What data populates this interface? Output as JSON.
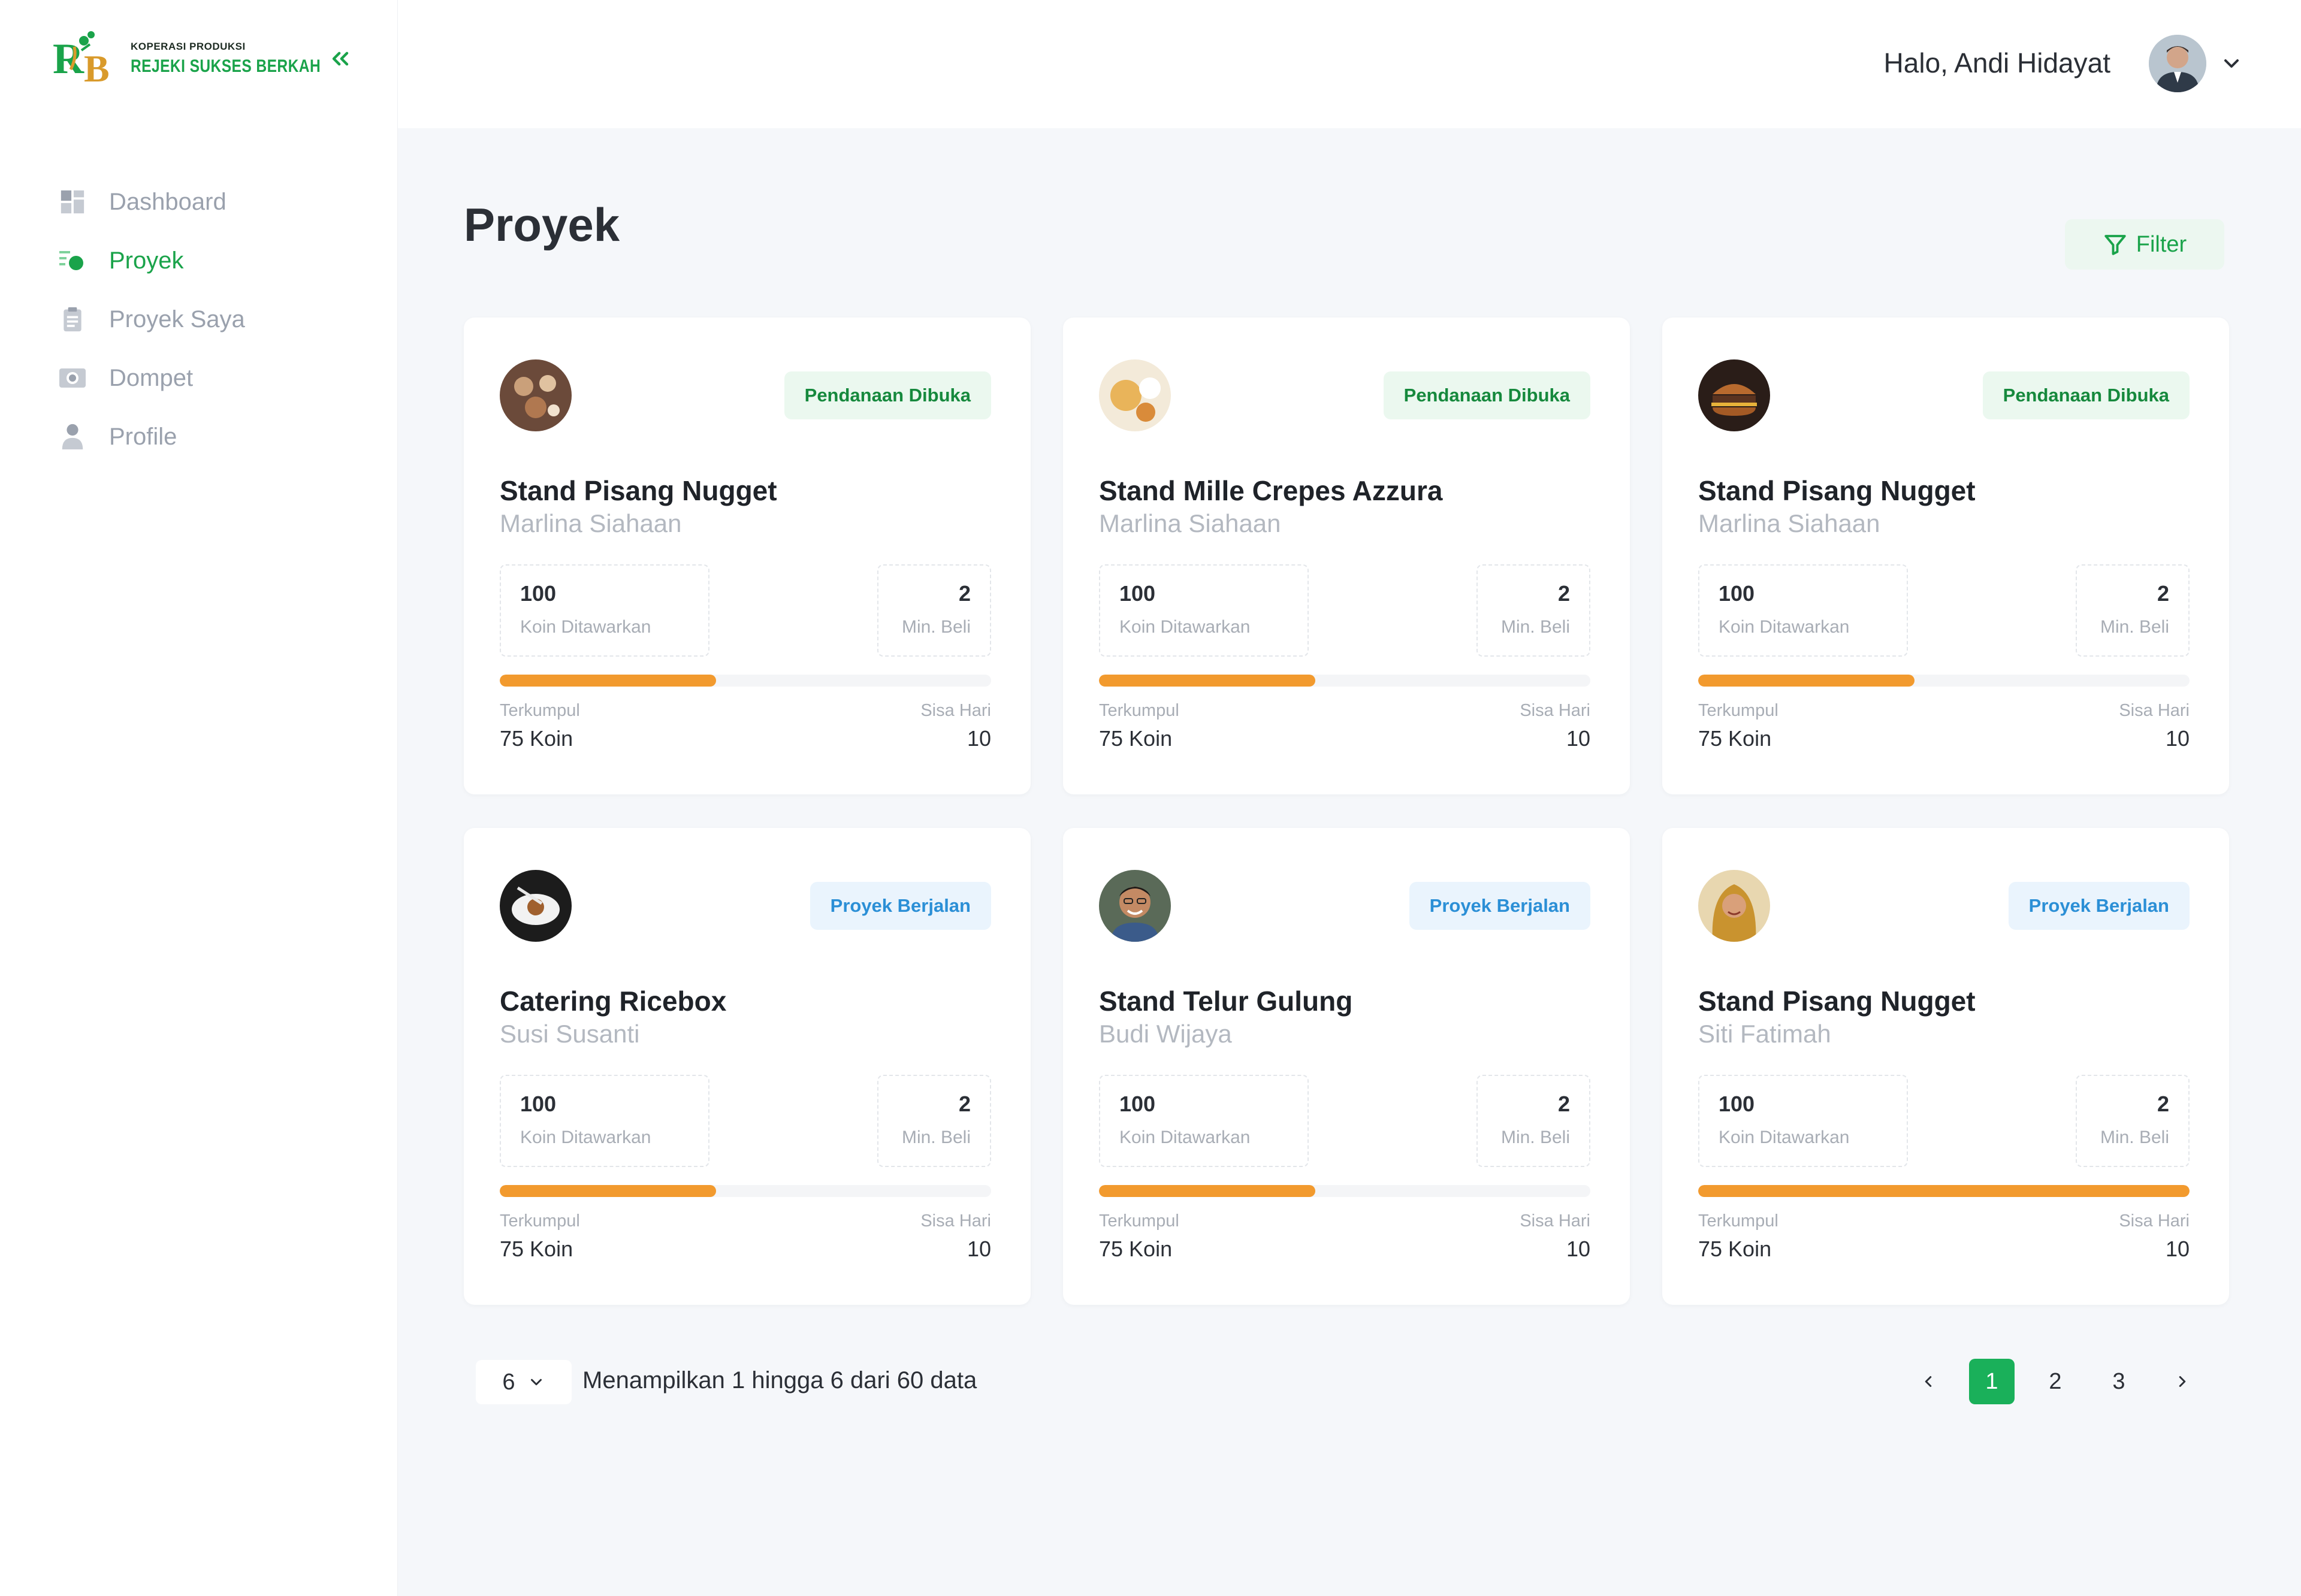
{
  "brand": {
    "small": "KOPERASI PRODUKSI",
    "name": "REJEKI SUKSES BERKAH",
    "accent": "#1aa34a",
    "gold": "#d99a2b"
  },
  "sidebar": {
    "items": [
      {
        "label": "Dashboard",
        "icon": "dashboard-icon",
        "active": false
      },
      {
        "label": "Proyek",
        "icon": "proyek-icon",
        "active": true
      },
      {
        "label": "Proyek Saya",
        "icon": "clipboard-icon",
        "active": false
      },
      {
        "label": "Dompet",
        "icon": "wallet-icon",
        "active": false
      },
      {
        "label": "Profile",
        "icon": "user-icon",
        "active": false
      }
    ]
  },
  "header": {
    "greeting": "Halo, Andi Hidayat"
  },
  "main": {
    "title": "Proyek",
    "filter_label": "Filter",
    "cards": [
      {
        "title": "Stand Pisang Nugget",
        "owner": "Marlina Siahaan",
        "status": "Pendanaan Dibuka",
        "status_type": "open",
        "koin": "100",
        "koin_label": "Koin Ditawarkan",
        "min": "2",
        "min_label": "Min. Beli",
        "progress": 0.44,
        "collected_label": "Terkumpul",
        "collected": "75 Koin",
        "days_label": "Sisa Hari",
        "days": "10",
        "avatar": "food-avatar"
      },
      {
        "title": "Stand Mille Crepes Azzura",
        "owner": "Marlina Siahaan",
        "status": "Pendanaan Dibuka",
        "status_type": "open",
        "koin": "100",
        "koin_label": "Koin Ditawarkan",
        "min": "2",
        "min_label": "Min. Beli",
        "progress": 0.44,
        "collected_label": "Terkumpul",
        "collected": "75 Koin",
        "days_label": "Sisa Hari",
        "days": "10",
        "avatar": "crepes-avatar"
      },
      {
        "title": "Stand Pisang Nugget",
        "owner": "Marlina Siahaan",
        "status": "Pendanaan Dibuka",
        "status_type": "open",
        "koin": "100",
        "koin_label": "Koin Ditawarkan",
        "min": "2",
        "min_label": "Min. Beli",
        "progress": 0.44,
        "collected_label": "Terkumpul",
        "collected": "75 Koin",
        "days_label": "Sisa Hari",
        "days": "10",
        "avatar": "burger-avatar"
      },
      {
        "title": "Catering Ricebox",
        "owner": "Susi Susanti",
        "status": "Proyek Berjalan",
        "status_type": "running",
        "koin": "100",
        "koin_label": "Koin Ditawarkan",
        "min": "2",
        "min_label": "Min. Beli",
        "progress": 0.44,
        "collected_label": "Terkumpul",
        "collected": "75 Koin",
        "days_label": "Sisa Hari",
        "days": "10",
        "avatar": "plate-avatar"
      },
      {
        "title": "Stand Telur Gulung",
        "owner": "Budi Wijaya",
        "status": "Proyek Berjalan",
        "status_type": "running",
        "koin": "100",
        "koin_label": "Koin Ditawarkan",
        "min": "2",
        "min_label": "Min. Beli",
        "progress": 0.44,
        "collected_label": "Terkumpul",
        "collected": "75 Koin",
        "days_label": "Sisa Hari",
        "days": "10",
        "avatar": "man-avatar"
      },
      {
        "title": "Stand Pisang Nugget",
        "owner": "Siti Fatimah",
        "status": "Proyek Berjalan",
        "status_type": "running",
        "koin": "100",
        "koin_label": "Koin Ditawarkan",
        "min": "2",
        "min_label": "Min. Beli",
        "progress": 1.0,
        "collected_label": "Terkumpul",
        "collected": "75 Koin",
        "days_label": "Sisa Hari",
        "days": "10",
        "avatar": "woman-avatar"
      }
    ]
  },
  "pagination": {
    "page_size": "6",
    "showing": "Menampilkan 1 hingga 6 dari 60 data",
    "pages": [
      "1",
      "2",
      "3"
    ],
    "current": "1"
  }
}
